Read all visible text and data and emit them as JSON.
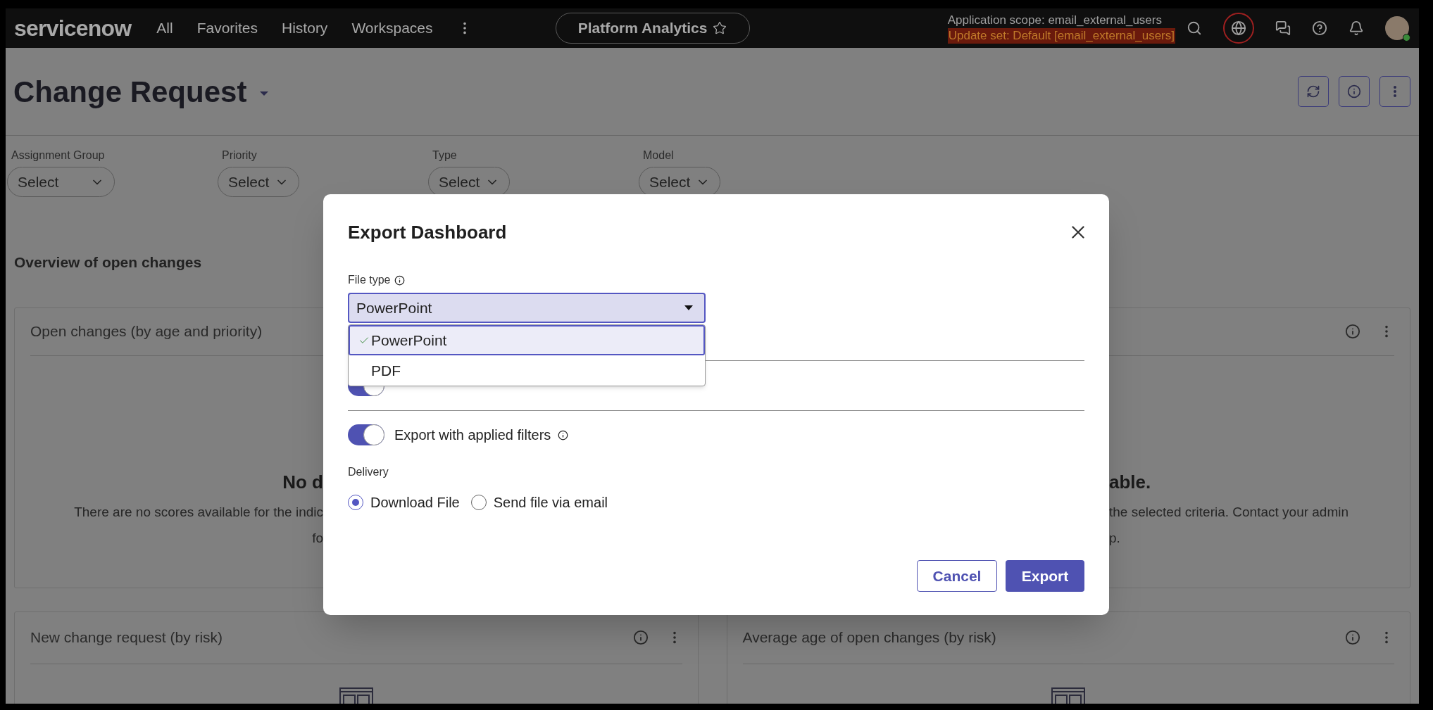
{
  "top_bar": {
    "logo": "servicenow",
    "nav": [
      "All",
      "Favorites",
      "History",
      "Workspaces"
    ],
    "center_tab": "Platform Analytics",
    "scope": "Application scope: email_external_users",
    "update_set": "Update set: Default [email_external_users]"
  },
  "page": {
    "title": "Change Request",
    "filters": [
      {
        "label": "Assignment Group",
        "value": "Select"
      },
      {
        "label": "Priority",
        "value": "Select"
      },
      {
        "label": "Type",
        "value": "Select"
      },
      {
        "label": "Model",
        "value": "Select"
      }
    ],
    "section_title": "Overview of open changes"
  },
  "main_card": {
    "title": "Open changes (by age and priority)",
    "empty_title_left": "No d",
    "empty_title_right": "able.",
    "empty_text_left": [
      "There are no scores available for the indic",
      "fo"
    ],
    "empty_text_right": [
      "the selected criteria. Contact your admin",
      "p."
    ]
  },
  "cards": [
    {
      "title": "New change request (by risk)"
    },
    {
      "title": "Average age of open changes (by risk)"
    }
  ],
  "dialog": {
    "title": "Export Dashboard",
    "file_type_label": "File type",
    "file_type_value": "PowerPoint",
    "options": [
      {
        "label": "PowerPoint",
        "selected": true
      },
      {
        "label": "PDF",
        "selected": false
      }
    ],
    "covered_toggle": {
      "on": true
    },
    "filters_toggle": {
      "label": "Export with applied filters",
      "on": true
    },
    "delivery": {
      "label": "Delivery",
      "options": [
        {
          "label": "Download File",
          "selected": true
        },
        {
          "label": "Send file via email",
          "selected": false
        }
      ]
    },
    "cancel": "Cancel",
    "export": "Export"
  }
}
